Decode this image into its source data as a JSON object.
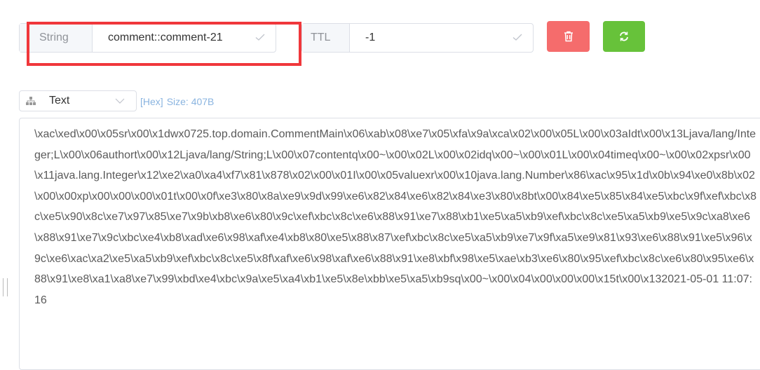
{
  "key": {
    "type_label": "String",
    "value": "comment::comment-21"
  },
  "ttl": {
    "label": "TTL",
    "value": "-1"
  },
  "actions": {
    "delete_icon": "trash-icon",
    "refresh_icon": "refresh-icon",
    "delete_color": "#f56c6c",
    "refresh_color": "#67c23a"
  },
  "viewer": {
    "format": "Text",
    "format_icon": "sitemap-icon",
    "hex_label": "[Hex]",
    "size_label": "Size: 407B",
    "content": "\\xac\\xed\\x00\\x05sr\\x00\\x1dwx0725.top.domain.CommentMain\\x06\\xab\\x08\\xe7\\x05\\xfa\\x9a\\xca\\x02\\x00\\x05L\\x00\\x03aIdt\\x00\\x13Ljava/lang/Integer;L\\x00\\x06authort\\x00\\x12Ljava/lang/String;L\\x00\\x07contentq\\x00~\\x00\\x02L\\x00\\x02idq\\x00~\\x00\\x01L\\x00\\x04timeq\\x00~\\x00\\x02xpsr\\x00\\x11java.lang.Integer\\x12\\xe2\\xa0\\xa4\\xf7\\x81\\x878\\x02\\x00\\x01I\\x00\\x05valuexr\\x00\\x10java.lang.Number\\x86\\xac\\x95\\x1d\\x0b\\x94\\xe0\\x8b\\x02\\x00\\x00xp\\x00\\x00\\x00\\x01t\\x00\\x0f\\xe3\\x80\\x8a\\xe9\\x9d\\x99\\xe6\\x82\\x84\\xe6\\x82\\x84\\xe3\\x80\\x8bt\\x00\\x84\\xe5\\x85\\x84\\xe5\\xbc\\x9f\\xef\\xbc\\x8c\\xe5\\x90\\x8c\\xe7\\x97\\x85\\xe7\\x9b\\xb8\\xe6\\x80\\x9c\\xef\\xbc\\x8c\\xe6\\x88\\x91\\xe7\\x88\\xb1\\xe5\\xa5\\xb9\\xef\\xbc\\x8c\\xe5\\xa5\\xb9\\xe5\\x9c\\xa8\\xe6\\x88\\x91\\xe7\\x9c\\xbc\\xe4\\xb8\\xad\\xe6\\x98\\xaf\\xe4\\xb8\\x80\\xe5\\x88\\x87\\xef\\xbc\\x8c\\xe5\\xa5\\xb9\\xe7\\x9f\\xa5\\xe9\\x81\\x93\\xe6\\x88\\x91\\xe5\\x96\\x9c\\xe6\\xac\\xa2\\xe5\\xa5\\xb9\\xef\\xbc\\x8c\\xe5\\x8f\\xaf\\xe6\\x98\\xaf\\xe6\\x88\\x91\\xe8\\xbf\\x98\\xe5\\xae\\xb3\\xe6\\x80\\x95\\xef\\xbc\\x8c\\xe6\\x80\\x95\\xe6\\x88\\x91\\xe8\\xa1\\xa8\\xe7\\x99\\xbd\\xe4\\xbc\\x9a\\xe5\\xa4\\xb1\\xe5\\x8e\\xbb\\xe5\\xa5\\xb9sq\\x00~\\x00\\x04\\x00\\x00\\x00\\x15t\\x00\\x132021-05-01 11:07:16"
  }
}
